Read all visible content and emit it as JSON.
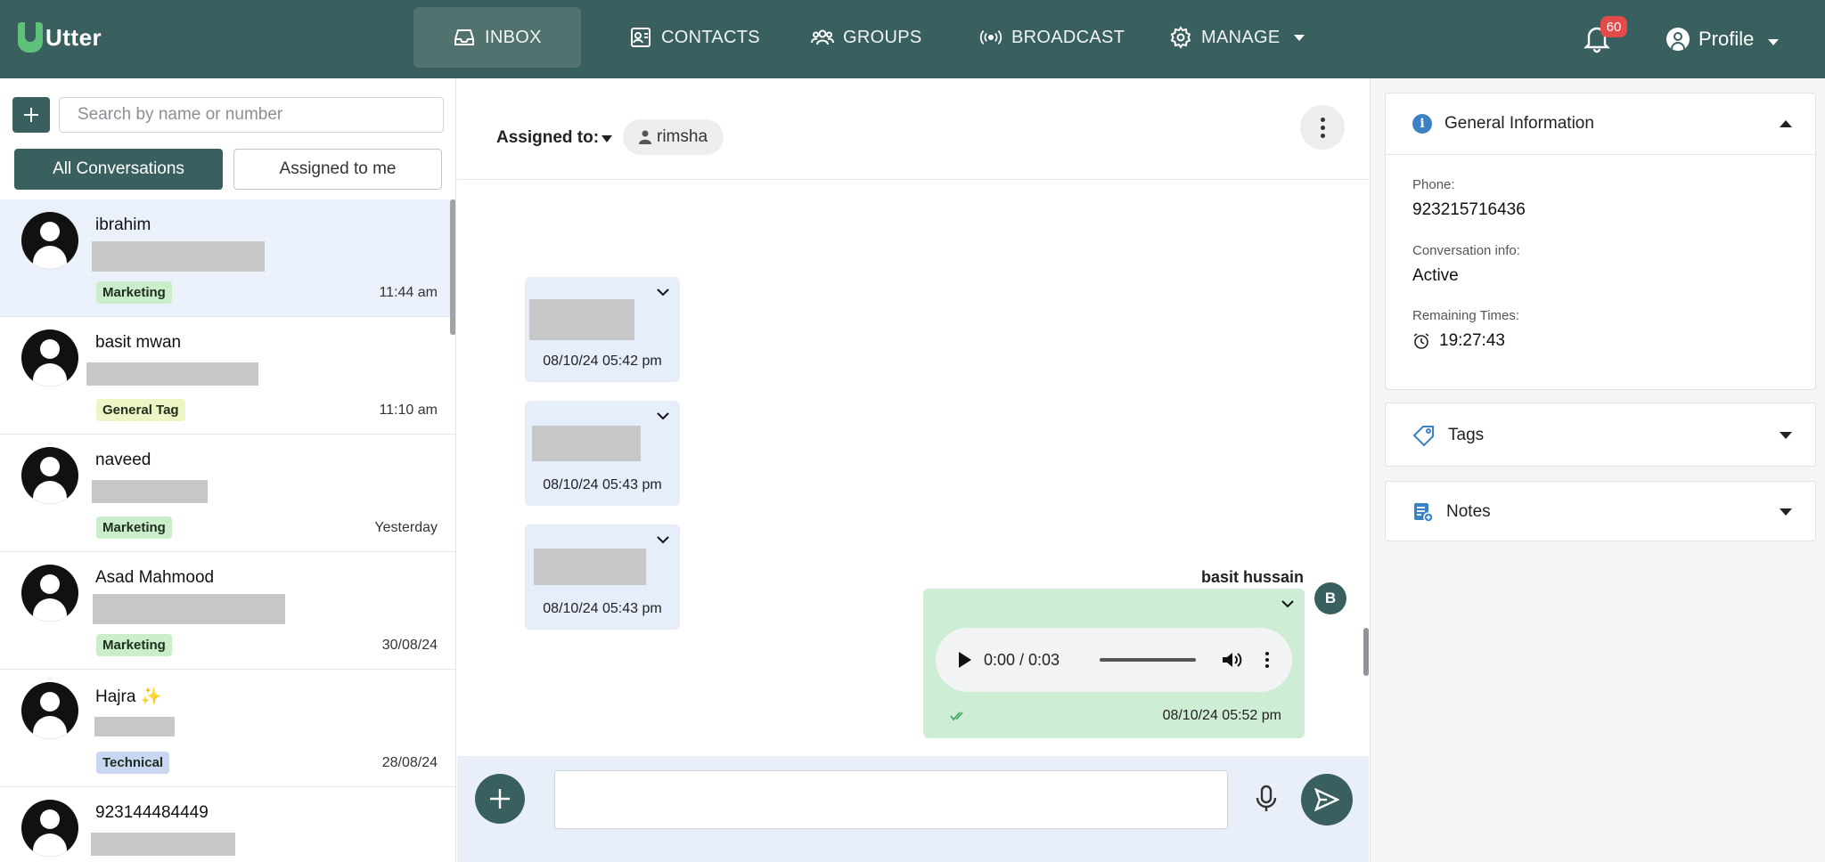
{
  "app": {
    "name": "Utter"
  },
  "nav": {
    "inbox": "INBOX",
    "contacts": "CONTACTS",
    "groups": "GROUPS",
    "broadcast": "BROADCAST",
    "manage": "MANAGE",
    "notification_count": "60",
    "profile": "Profile"
  },
  "sidebar": {
    "search_placeholder": "Search by name or number",
    "filters": {
      "all": "All Conversations",
      "mine": "Assigned to me"
    },
    "conversations": [
      {
        "name": "ibrahim",
        "tag": "Marketing",
        "time": "11:44 am",
        "tag_color": "#c9eec9"
      },
      {
        "name": "basit mwan",
        "tag": "General Tag",
        "time": "11:10 am",
        "tag_color": "#eef5c4"
      },
      {
        "name": "naveed",
        "tag": "Marketing",
        "time": "Yesterday",
        "tag_color": "#c9eec9"
      },
      {
        "name": "Asad Mahmood",
        "tag": "Marketing",
        "time": "30/08/24",
        "tag_color": "#c9eec9"
      },
      {
        "name": "Hajra ✨",
        "tag": "Technical",
        "time": "28/08/24",
        "tag_color": "#c9d7f2"
      },
      {
        "name": "923144484449",
        "tag": "",
        "time": "",
        "tag_color": ""
      }
    ]
  },
  "chat": {
    "assigned_label": "Assigned to:",
    "assignee": "rimsha",
    "messages": [
      {
        "timestamp": "08/10/24 05:42 pm"
      },
      {
        "timestamp": "08/10/24 05:43 pm"
      },
      {
        "timestamp": "08/10/24 05:43 pm"
      }
    ],
    "outgoing": {
      "sender": "basit hussain",
      "avatar_initial": "B",
      "audio_time": "0:00 / 0:03",
      "timestamp": "08/10/24 05:52 pm"
    }
  },
  "details": {
    "general_title": "General Information",
    "phone_label": "Phone:",
    "phone": "923215716436",
    "conv_info_label": "Conversation info:",
    "conv_info": "Active",
    "remaining_label": "Remaining Times:",
    "remaining": "19:27:43",
    "tags_title": "Tags",
    "notes_title": "Notes"
  },
  "colors": {
    "brand": "#3a5f5f",
    "incoming_bubble": "#e6eefb",
    "outgoing_bubble": "#cdeed4",
    "badge": "#e34a4a"
  }
}
